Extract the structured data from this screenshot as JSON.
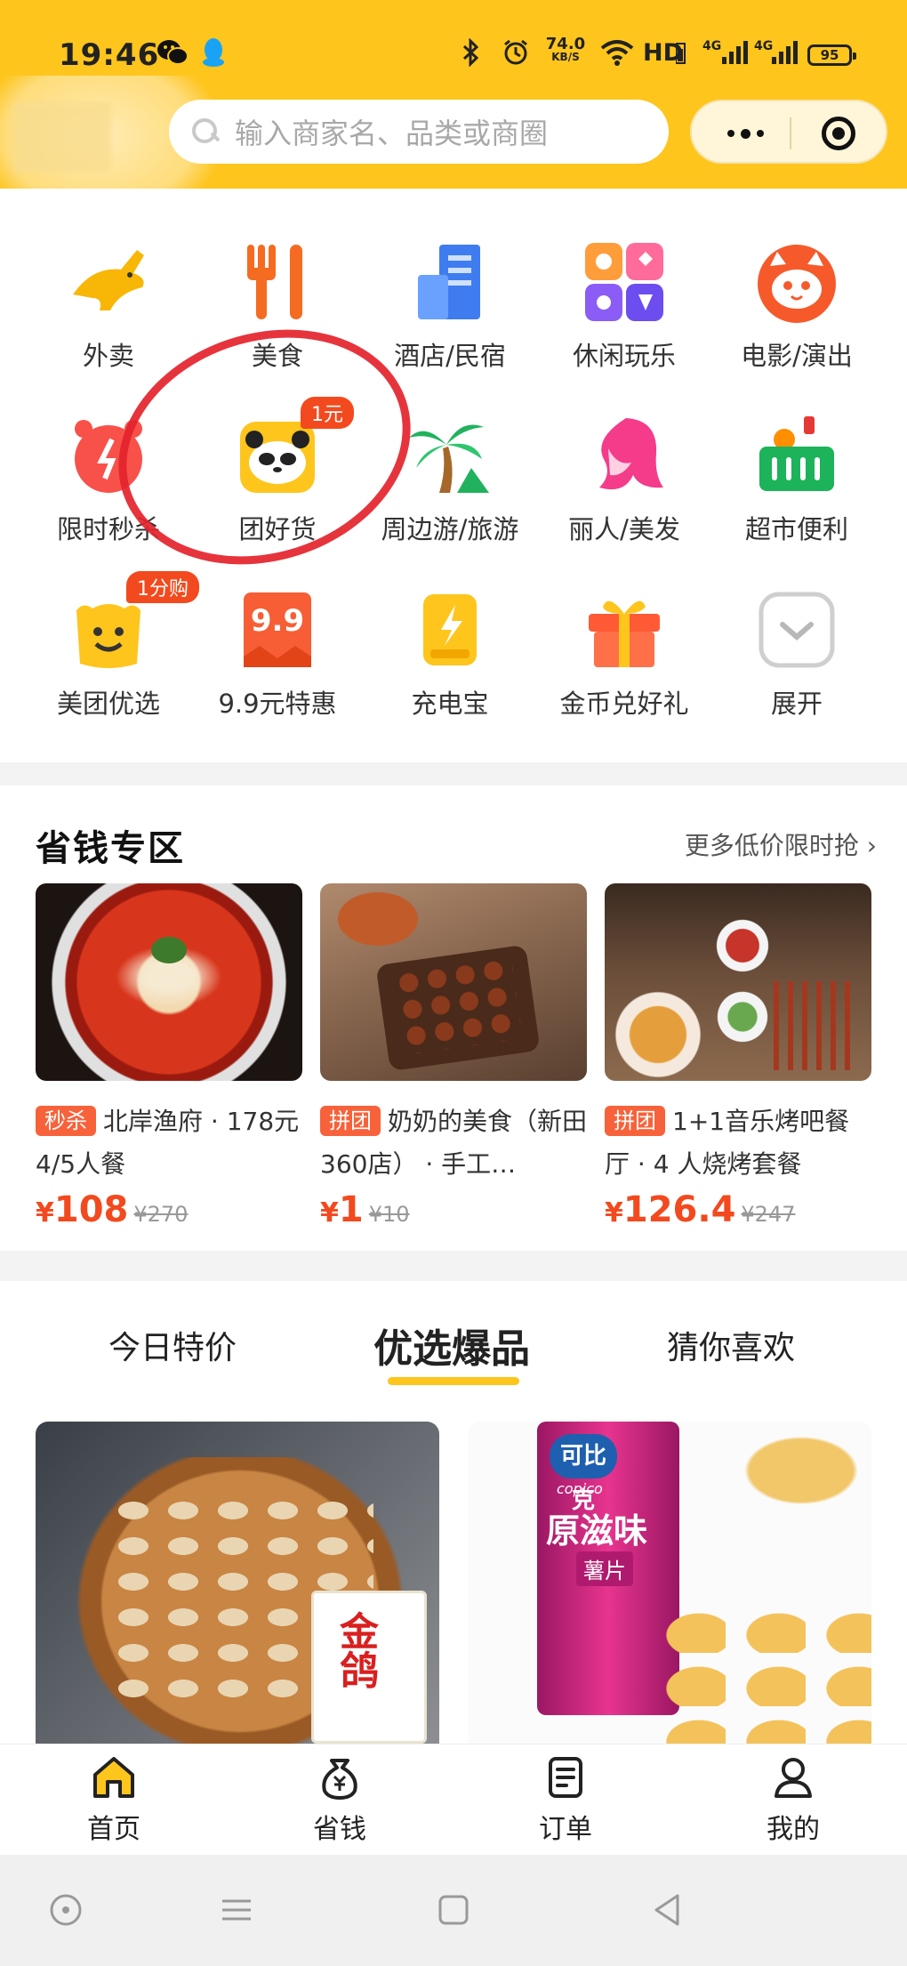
{
  "status_bar": {
    "time": "19:46",
    "speed_value": "74.0",
    "speed_unit": "KB/S",
    "hd": "HD",
    "net1": "4G",
    "net2": "4G",
    "battery": "95"
  },
  "search": {
    "placeholder": "输入商家名、品类或商圈"
  },
  "categories": [
    {
      "label": "外卖",
      "icon": "kangaroo-icon"
    },
    {
      "label": "美食",
      "icon": "fork-knife-icon"
    },
    {
      "label": "酒店/民宿",
      "icon": "hotel-building-icon"
    },
    {
      "label": "休闲玩乐",
      "icon": "leisure-grid-icon"
    },
    {
      "label": "电影/演出",
      "icon": "cat-face-icon"
    },
    {
      "label": "限时秒杀",
      "icon": "alarm-clock-icon"
    },
    {
      "label": "团好货",
      "icon": "panda-icon",
      "badge": "1元"
    },
    {
      "label": "周边游/旅游",
      "icon": "palm-tree-icon"
    },
    {
      "label": "丽人/美发",
      "icon": "woman-hair-icon"
    },
    {
      "label": "超市便利",
      "icon": "shopping-basket-icon"
    },
    {
      "label": "美团优选",
      "icon": "smile-bag-icon",
      "badge": "1分购"
    },
    {
      "label": "9.9元特惠",
      "icon": "nine-nine-tag-icon",
      "icon_text": "9.9"
    },
    {
      "label": "充电宝",
      "icon": "power-bank-icon"
    },
    {
      "label": "金币兑好礼",
      "icon": "gift-box-icon"
    },
    {
      "label": "展开",
      "icon": "chevron-down-icon"
    }
  ],
  "saving_zone": {
    "title": "省钱专区",
    "more": "更多低价限时抢",
    "deals": [
      {
        "tag": "秒杀",
        "text": "北岸渔府 · 178元4/5人餐",
        "currency": "¥",
        "price": "108",
        "old_price": "¥270"
      },
      {
        "tag": "拼团",
        "text": "奶奶的美食（新田360店） · 手工…",
        "currency": "¥",
        "price": "1",
        "old_price": "¥10"
      },
      {
        "tag": "拼团",
        "text": "1+1音乐烤吧餐厅 · 4 人烧烤套餐",
        "currency": "¥",
        "price": "126.4",
        "old_price": "¥247"
      }
    ]
  },
  "feed_tabs": {
    "tab1": "今日特价",
    "tab2": "优选爆品",
    "tab3": "猜你喜欢",
    "active": "优选爆品"
  },
  "products": {
    "p1_brand": "金鸽",
    "p2_brand": "可比克",
    "p2_brand_en": "copico",
    "p2_flavor": "原滋味",
    "p2_type": "薯片"
  },
  "tab_bar": {
    "home": "首页",
    "save": "省钱",
    "orders": "订单",
    "mine": "我的",
    "active": "首页"
  },
  "colors": {
    "brand_yellow": "#fec51d",
    "accent_red": "#f24a1e",
    "tag_orange": "#f7623a"
  }
}
